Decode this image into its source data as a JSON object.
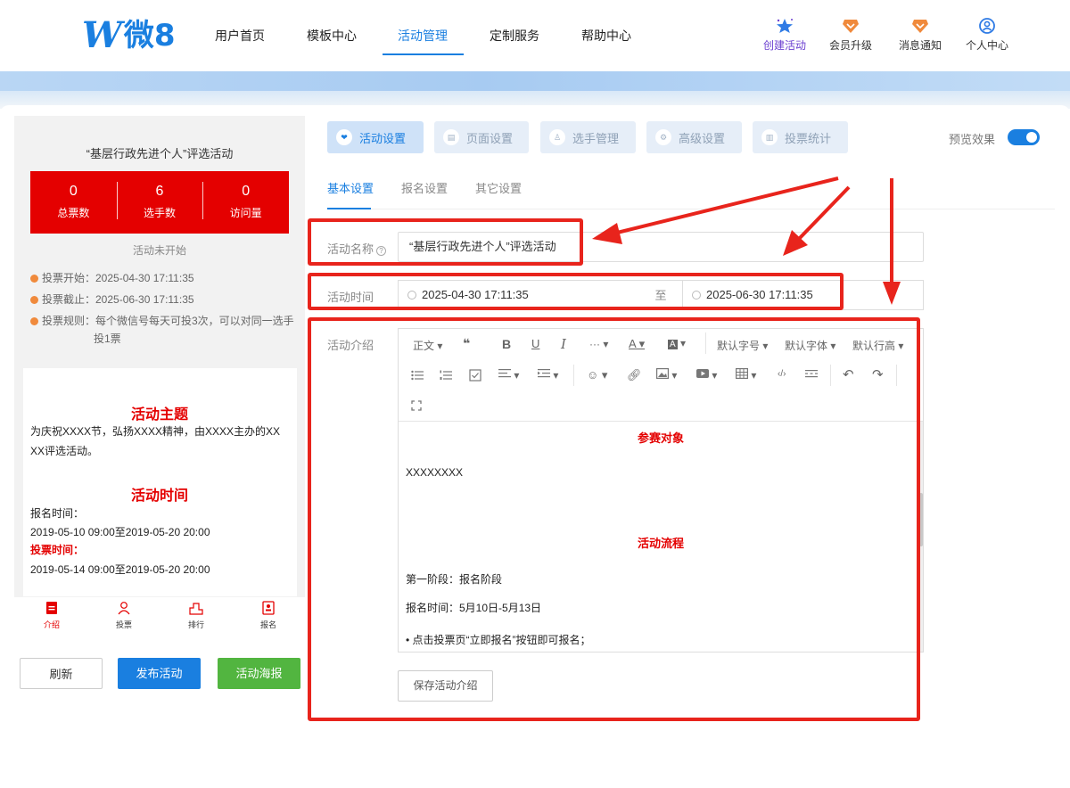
{
  "nav": {
    "logo_w": "W",
    "logo_text": "微8",
    "items": [
      "用户首页",
      "模板中心",
      "活动管理",
      "定制服务",
      "帮助中心"
    ],
    "active_index": 2,
    "actions": [
      {
        "label": "创建活动",
        "icon": "star-icon"
      },
      {
        "label": "会员升级",
        "icon": "crown-icon"
      },
      {
        "label": "消息通知",
        "icon": "bell-icon"
      },
      {
        "label": "个人中心",
        "icon": "user-icon"
      }
    ]
  },
  "preview": {
    "title": "“基层行政先进个人”评选活动",
    "stats": [
      {
        "value": "0",
        "label": "总票数"
      },
      {
        "value": "6",
        "label": "选手数"
      },
      {
        "value": "0",
        "label": "访问量"
      }
    ],
    "status": "活动未开始",
    "info": [
      "投票开始：2025-04-30 17:11:35",
      "投票截止：2025-06-30 17:11:35",
      "投票规则：每个微信号每天可投3次，可以对同一选手",
      "投1票"
    ],
    "theme_title": "活动主题",
    "theme_text_1": "为庆祝XXXX节，弘扬XXXX精神，由XXXX主办的XX",
    "theme_text_2": "XX评选活动。",
    "time_title": "活动时间",
    "signup_label": "报名时间：",
    "signup_value": "2019-05-10 09:00至2019-05-20 20:00",
    "vote_label": "投票时间：",
    "vote_value": "2019-05-14 09:00至2019-05-20 20:00",
    "tabs": [
      "介绍",
      "投票",
      "排行",
      "报名"
    ],
    "buttons": {
      "refresh": "刷新",
      "publish": "发布活动",
      "poster": "活动海报"
    }
  },
  "settings": {
    "top_tabs": [
      "活动设置",
      "页面设置",
      "选手管理",
      "高级设置",
      "投票统计"
    ],
    "preview_label": "预览效果",
    "preview_on": true,
    "sub_tabs": [
      "基本设置",
      "报名设置",
      "其它设置"
    ],
    "name_label": "活动名称",
    "name_value": "“基层行政先进个人”评选活动",
    "time_label": "活动时间",
    "time_start": "2025-04-30 17:11:35",
    "time_sep": "至",
    "time_end": "2025-06-30 17:11:35",
    "intro_label": "活动介绍",
    "toolbar": {
      "paragraph": "正文",
      "quote": "❝",
      "bold": "B",
      "underline": "U",
      "italic": "I",
      "more": "···",
      "font_color": "A",
      "bg_color": "A",
      "font_size": "默认字号",
      "font_family": "默认字体",
      "line_height": "默认行高"
    },
    "editor": {
      "heading1": "参赛对象",
      "line1": "XXXXXXXX",
      "heading2": "活动流程",
      "line2": "第一阶段：报名阶段",
      "line3": "报名时间：5月10日-5月13日",
      "line4": "• 点击投票页“立即报名”按钮即可报名；"
    },
    "save_button": "保存活动介绍"
  },
  "colors": {
    "accent": "#1a7fe0",
    "red": "#e40000",
    "annotation": "#e8241c",
    "green": "#52b540"
  }
}
